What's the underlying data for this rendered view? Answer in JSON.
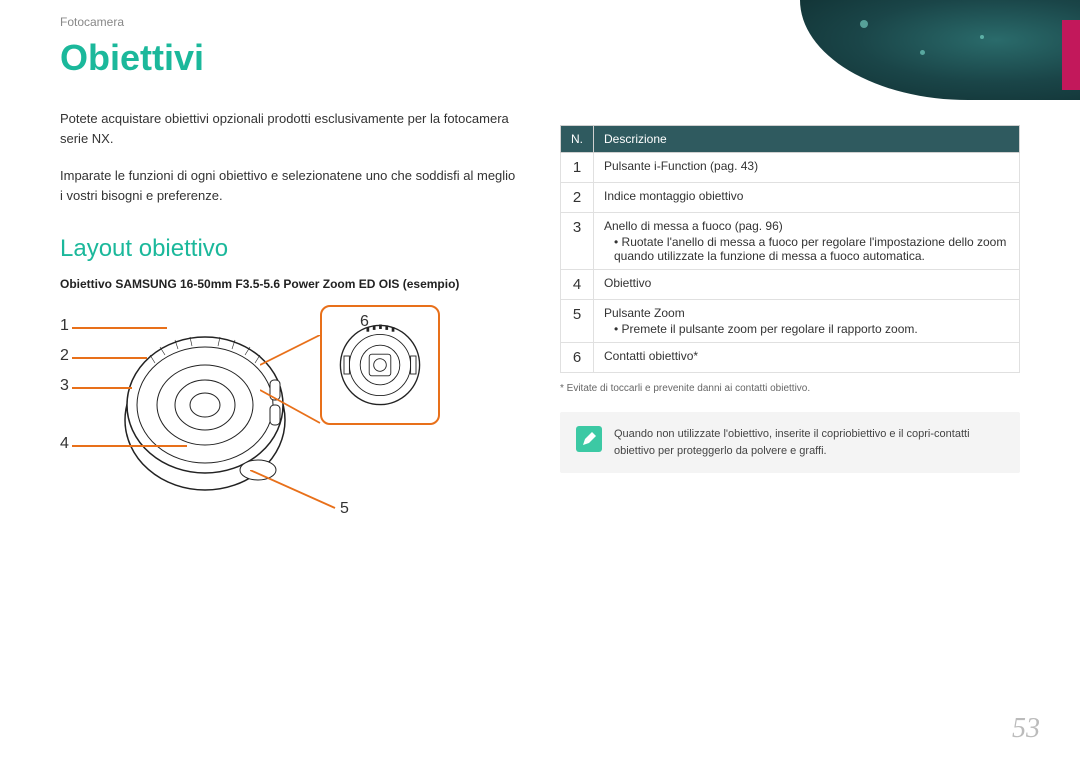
{
  "breadcrumb": "Fotocamera",
  "title": "Obiettivi",
  "intro": {
    "p1": "Potete acquistare obiettivi opzionali prodotti esclusivamente per la fotocamera serie NX.",
    "p2": "Imparate le funzioni di ogni obiettivo e selezionatene uno che soddisfi al meglio i vostri bisogni e preferenze."
  },
  "section_title": "Layout obiettivo",
  "lens_caption": "Obiettivo SAMSUNG 16-50mm F3.5-5.6 Power Zoom ED OIS (esempio)",
  "diagram_labels": {
    "n1": "1",
    "n2": "2",
    "n3": "3",
    "n4": "4",
    "n5": "5",
    "n6": "6"
  },
  "table": {
    "head_num": "N.",
    "head_desc": "Descrizione",
    "rows": [
      {
        "n": "1",
        "desc": "Pulsante i-Function (pag. 43)"
      },
      {
        "n": "2",
        "desc": "Indice montaggio obiettivo"
      },
      {
        "n": "3",
        "desc": "Anello di messa a fuoco (pag. 96)",
        "bullet": "Ruotate l'anello di messa a fuoco per regolare l'impostazione dello zoom quando utilizzate la funzione di messa a fuoco automatica."
      },
      {
        "n": "4",
        "desc": "Obiettivo"
      },
      {
        "n": "5",
        "desc": "Pulsante Zoom",
        "bullet": "Premete il pulsante zoom per regolare il rapporto zoom."
      },
      {
        "n": "6",
        "desc": "Contatti obiettivo*"
      }
    ]
  },
  "footnote": "* Evitate di toccarli e prevenite danni ai contatti obiettivo.",
  "note": "Quando non utilizzate l'obiettivo, inserite il copriobiettivo e il copri-contatti obiettivo per proteggerlo da polvere e graffi.",
  "page_number": "53"
}
